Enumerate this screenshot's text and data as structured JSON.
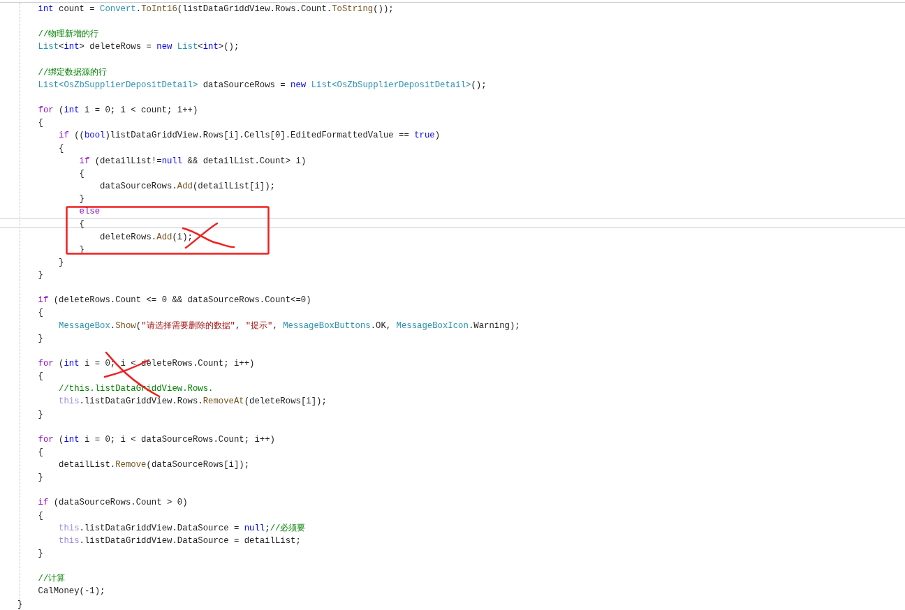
{
  "editor": {
    "blocks": [
      [
        {
          "tokens": [
            {
              "text": "    int",
              "kind": "keyword"
            },
            {
              "text": " count = ",
              "kind": "plain"
            },
            {
              "text": "Convert",
              "kind": "type"
            },
            {
              "text": ".",
              "kind": "plain"
            },
            {
              "text": "ToInt16",
              "kind": "method"
            },
            {
              "text": "(listDataGriddView.Rows.Count.",
              "kind": "plain"
            },
            {
              "text": "ToString",
              "kind": "method"
            },
            {
              "text": "());",
              "kind": "plain"
            }
          ]
        }
      ],
      [
        {
          "tokens": [
            {
              "text": "    //物理新增的行",
              "kind": "comment"
            }
          ]
        },
        {
          "tokens": [
            {
              "text": "    List",
              "kind": "type"
            },
            {
              "text": "<",
              "kind": "plain"
            },
            {
              "text": "int",
              "kind": "keyword"
            },
            {
              "text": "> deleteRows = ",
              "kind": "plain"
            },
            {
              "text": "new",
              "kind": "keyword"
            },
            {
              "text": " List",
              "kind": "type"
            },
            {
              "text": "<",
              "kind": "plain"
            },
            {
              "text": "int",
              "kind": "keyword"
            },
            {
              "text": ">();",
              "kind": "plain"
            }
          ]
        }
      ],
      [
        {
          "tokens": [
            {
              "text": "    //绑定数据源的行",
              "kind": "comment"
            }
          ]
        },
        {
          "tokens": [
            {
              "text": "    List<OsZbSupplierDepositDetail>",
              "kind": "type"
            },
            {
              "text": " dataSourceRows = ",
              "kind": "plain"
            },
            {
              "text": "new",
              "kind": "keyword"
            },
            {
              "text": " List<OsZbSupplierDepositDetail>",
              "kind": "type"
            },
            {
              "text": "();",
              "kind": "plain"
            }
          ]
        }
      ],
      [
        {
          "tokens": [
            {
              "text": "    for",
              "kind": "control"
            },
            {
              "text": " (",
              "kind": "plain"
            },
            {
              "text": "int",
              "kind": "keyword"
            },
            {
              "text": " i = 0; i < count; i++)",
              "kind": "plain"
            }
          ]
        },
        {
          "tokens": [
            {
              "text": "    {",
              "kind": "plain"
            }
          ]
        },
        {
          "tokens": [
            {
              "text": "        if",
              "kind": "control"
            },
            {
              "text": " ((",
              "kind": "plain"
            },
            {
              "text": "bool",
              "kind": "keyword"
            },
            {
              "text": ")listDataGriddView.Rows[i].Cells[0].EditedFormattedValue == ",
              "kind": "plain"
            },
            {
              "text": "true",
              "kind": "keyword"
            },
            {
              "text": ")",
              "kind": "plain"
            }
          ]
        },
        {
          "tokens": [
            {
              "text": "        {",
              "kind": "plain"
            }
          ]
        },
        {
          "tokens": [
            {
              "text": "            if",
              "kind": "control"
            },
            {
              "text": " (detailList!=",
              "kind": "plain"
            },
            {
              "text": "null",
              "kind": "keyword"
            },
            {
              "text": " && detailList.Count> i)",
              "kind": "plain"
            }
          ]
        },
        {
          "tokens": [
            {
              "text": "            {",
              "kind": "plain"
            }
          ]
        },
        {
          "tokens": [
            {
              "text": "                dataSourceRows.",
              "kind": "plain"
            },
            {
              "text": "Add",
              "kind": "method"
            },
            {
              "text": "(detailList[i]);",
              "kind": "plain"
            }
          ]
        },
        {
          "tokens": [
            {
              "text": "            }",
              "kind": "plain"
            }
          ]
        },
        {
          "tokens": [
            {
              "text": "            else",
              "kind": "control"
            }
          ]
        },
        {
          "tokens": [
            {
              "text": "            {",
              "kind": "plain"
            }
          ]
        },
        {
          "tokens": [
            {
              "text": "                deleteRows.",
              "kind": "plain"
            },
            {
              "text": "Add",
              "kind": "method"
            },
            {
              "text": "(i);",
              "kind": "plain"
            }
          ]
        },
        {
          "tokens": [
            {
              "text": "            }",
              "kind": "plain"
            }
          ]
        },
        {
          "tokens": [
            {
              "text": "        }",
              "kind": "plain"
            }
          ]
        },
        {
          "tokens": [
            {
              "text": "    }",
              "kind": "plain"
            }
          ]
        }
      ],
      [
        {
          "tokens": [
            {
              "text": "    if",
              "kind": "control"
            },
            {
              "text": " (deleteRows.Count <= 0 && dataSourceRows.Count<=0)",
              "kind": "plain"
            }
          ]
        },
        {
          "tokens": [
            {
              "text": "    {",
              "kind": "plain"
            }
          ]
        },
        {
          "tokens": [
            {
              "text": "        MessageBox",
              "kind": "type"
            },
            {
              "text": ".",
              "kind": "plain"
            },
            {
              "text": "Show",
              "kind": "method"
            },
            {
              "text": "(",
              "kind": "plain"
            },
            {
              "text": "\"请选择需要删除的数据\"",
              "kind": "string"
            },
            {
              "text": ", ",
              "kind": "plain"
            },
            {
              "text": "\"提示\"",
              "kind": "string"
            },
            {
              "text": ", ",
              "kind": "plain"
            },
            {
              "text": "MessageBoxButtons",
              "kind": "type"
            },
            {
              "text": ".OK, ",
              "kind": "plain"
            },
            {
              "text": "MessageBoxIcon",
              "kind": "type"
            },
            {
              "text": ".Warning);",
              "kind": "plain"
            }
          ]
        },
        {
          "tokens": [
            {
              "text": "    }",
              "kind": "plain"
            }
          ]
        }
      ],
      [
        {
          "tokens": [
            {
              "text": "    for",
              "kind": "control"
            },
            {
              "text": " (",
              "kind": "plain"
            },
            {
              "text": "int",
              "kind": "keyword"
            },
            {
              "text": " i = 0; i < deleteRows.Count; i++)",
              "kind": "plain"
            }
          ]
        },
        {
          "tokens": [
            {
              "text": "    {",
              "kind": "plain"
            }
          ]
        },
        {
          "tokens": [
            {
              "text": "        //this.listDataGriddView.Rows.",
              "kind": "comment"
            }
          ]
        },
        {
          "tokens": [
            {
              "text": "        this",
              "kind": "this"
            },
            {
              "text": ".listDataGriddView.Rows.",
              "kind": "plain"
            },
            {
              "text": "RemoveAt",
              "kind": "method"
            },
            {
              "text": "(deleteRows[i]);",
              "kind": "plain"
            }
          ]
        },
        {
          "tokens": [
            {
              "text": "    }",
              "kind": "plain"
            }
          ]
        }
      ],
      [
        {
          "tokens": [
            {
              "text": "    for",
              "kind": "control"
            },
            {
              "text": " (",
              "kind": "plain"
            },
            {
              "text": "int",
              "kind": "keyword"
            },
            {
              "text": " i = 0; i < dataSourceRows.Count; i++)",
              "kind": "plain"
            }
          ]
        },
        {
          "tokens": [
            {
              "text": "    {",
              "kind": "plain"
            }
          ]
        },
        {
          "tokens": [
            {
              "text": "        detailList.",
              "kind": "plain"
            },
            {
              "text": "Remove",
              "kind": "method"
            },
            {
              "text": "(dataSourceRows[i]);",
              "kind": "plain"
            }
          ]
        },
        {
          "tokens": [
            {
              "text": "    }",
              "kind": "plain"
            }
          ]
        }
      ],
      [
        {
          "tokens": [
            {
              "text": "    if",
              "kind": "control"
            },
            {
              "text": " (dataSourceRows.Count > 0)",
              "kind": "plain"
            }
          ]
        },
        {
          "tokens": [
            {
              "text": "    {",
              "kind": "plain"
            }
          ]
        },
        {
          "tokens": [
            {
              "text": "        this",
              "kind": "this"
            },
            {
              "text": ".listDataGriddView.DataSource = ",
              "kind": "plain"
            },
            {
              "text": "null",
              "kind": "keyword"
            },
            {
              "text": ";",
              "kind": "plain"
            },
            {
              "text": "//必须要",
              "kind": "comment"
            }
          ]
        },
        {
          "tokens": [
            {
              "text": "        this",
              "kind": "this"
            },
            {
              "text": ".listDataGriddView.DataSource = detailList;",
              "kind": "plain"
            }
          ]
        },
        {
          "tokens": [
            {
              "text": "    }",
              "kind": "plain"
            }
          ]
        }
      ],
      [
        {
          "tokens": [
            {
              "text": "    //计算",
              "kind": "comment"
            }
          ]
        },
        {
          "tokens": [
            {
              "text": "    CalMoney(-1);",
              "kind": "plain"
            }
          ]
        },
        {
          "tokens": [
            {
              "text": "}",
              "kind": "plain"
            }
          ]
        }
      ]
    ]
  }
}
